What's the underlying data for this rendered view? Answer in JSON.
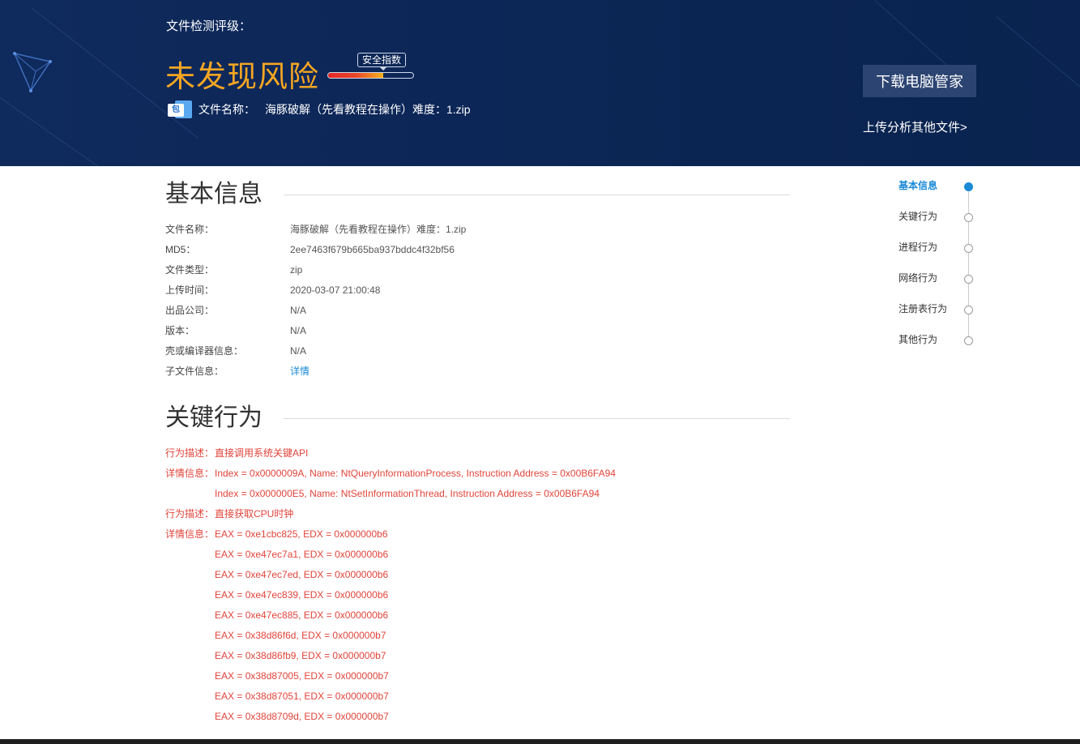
{
  "header": {
    "label": "文件检测评级：",
    "verdict": "未发现风险",
    "meter_label": "安全指数",
    "meter_level": 0.65,
    "file_icon_glyph": "包",
    "file_label": "文件名称：",
    "file_name": "海豚破解（先看教程在操作）难度：1.zip",
    "download_button": "下载电脑管家",
    "upload_link": "上传分析其他文件>"
  },
  "basic_info": {
    "title": "基本信息",
    "rows": [
      {
        "key": "文件名称：",
        "value": "海豚破解（先看教程在操作）难度：1.zip"
      },
      {
        "key": "MD5：",
        "value": "2ee7463f679b665ba937bddc4f32bf56"
      },
      {
        "key": "文件类型：",
        "value": "zip"
      },
      {
        "key": "上传时间：",
        "value": "2020-03-07 21:00:48"
      },
      {
        "key": "出品公司：",
        "value": "N/A"
      },
      {
        "key": "版本：",
        "value": "N/A"
      },
      {
        "key": "壳或编译器信息：",
        "value": "N/A"
      },
      {
        "key": "子文件信息：",
        "value": "详情"
      }
    ]
  },
  "key_behavior": {
    "title": "关键行为",
    "lines": [
      {
        "label": "行为描述：",
        "value": "直接调用系统关键API"
      },
      {
        "label": "详情信息：",
        "value": "Index = 0x0000009A, Name: NtQueryInformationProcess, Instruction Address = 0x00B6FA94"
      },
      {
        "label": "",
        "value": "Index = 0x000000E5, Name: NtSetInformationThread, Instruction Address = 0x00B6FA94"
      },
      {
        "label": "行为描述：",
        "value": "直接获取CPU时钟"
      },
      {
        "label": "详情信息：",
        "value": "EAX = 0xe1cbc825, EDX = 0x000000b6"
      },
      {
        "label": "",
        "value": "EAX = 0xe47ec7a1, EDX = 0x000000b6"
      },
      {
        "label": "",
        "value": "EAX = 0xe47ec7ed, EDX = 0x000000b6"
      },
      {
        "label": "",
        "value": "EAX = 0xe47ec839, EDX = 0x000000b6"
      },
      {
        "label": "",
        "value": "EAX = 0xe47ec885, EDX = 0x000000b6"
      },
      {
        "label": "",
        "value": "EAX = 0x38d86f6d, EDX = 0x000000b7"
      },
      {
        "label": "",
        "value": "EAX = 0x38d86fb9, EDX = 0x000000b7"
      },
      {
        "label": "",
        "value": "EAX = 0x38d87005, EDX = 0x000000b7"
      },
      {
        "label": "",
        "value": "EAX = 0x38d87051, EDX = 0x000000b7"
      },
      {
        "label": "",
        "value": "EAX = 0x38d8709d, EDX = 0x000000b7"
      }
    ]
  },
  "side_nav": {
    "items": [
      {
        "label": "基本信息",
        "active": true
      },
      {
        "label": "关键行为",
        "active": false
      },
      {
        "label": "进程行为",
        "active": false
      },
      {
        "label": "网络行为",
        "active": false
      },
      {
        "label": "注册表行为",
        "active": false
      },
      {
        "label": "其他行为",
        "active": false
      }
    ]
  },
  "colors": {
    "header_bg": "#0c2657",
    "verdict": "#f6a623",
    "accent": "#1a8ad6",
    "behavior_text": "#e0443a"
  }
}
